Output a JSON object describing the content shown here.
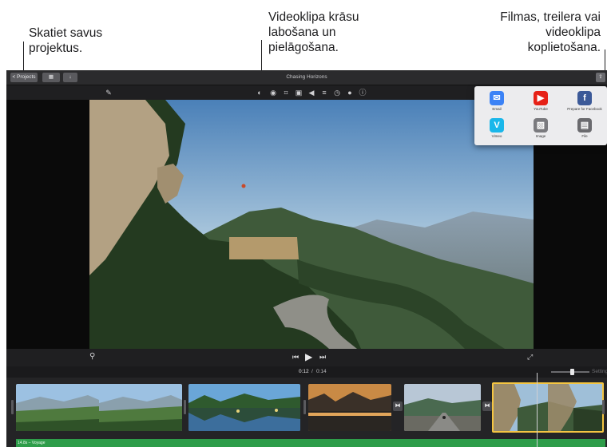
{
  "callouts": {
    "projects": "Skatiet savus projektus.",
    "adjust": "Videoklipa krāsu labošana un pielāgošana.",
    "share": "Filmas, treilera vai videoklipa koplietošana."
  },
  "titlebar": {
    "projects_button": "< Projects",
    "title": "Chasing Horizons"
  },
  "toolbar": {
    "tools": [
      "magic-wand-icon",
      "color-balance-icon",
      "color-correction-icon",
      "crop-icon",
      "stabilization-icon",
      "volume-icon",
      "equalizer-icon",
      "speed-icon",
      "noise-reduction-icon",
      "info-icon"
    ]
  },
  "share_popover": {
    "items": [
      {
        "label": "Email",
        "icon": "email-icon",
        "color": "#3b82f6"
      },
      {
        "label": "YouTube",
        "icon": "youtube-icon",
        "color": "#e62117"
      },
      {
        "label": "Prepare for Facebook",
        "icon": "facebook-icon",
        "color": "#3b5998"
      },
      {
        "label": "Vimeo",
        "icon": "vimeo-icon",
        "color": "#1ab7ea"
      },
      {
        "label": "Image",
        "icon": "image-icon",
        "color": "#7a7a7e"
      },
      {
        "label": "File",
        "icon": "file-icon",
        "color": "#6a6a6e"
      }
    ]
  },
  "timebar": {
    "current": "0:12",
    "total": "0:14",
    "settings": "Settings"
  },
  "timeline": {
    "audio_track_label": "14.8s – Voyage"
  },
  "colors": {
    "accent_selection": "#f4c542",
    "audio_track": "#2e9d4a"
  }
}
